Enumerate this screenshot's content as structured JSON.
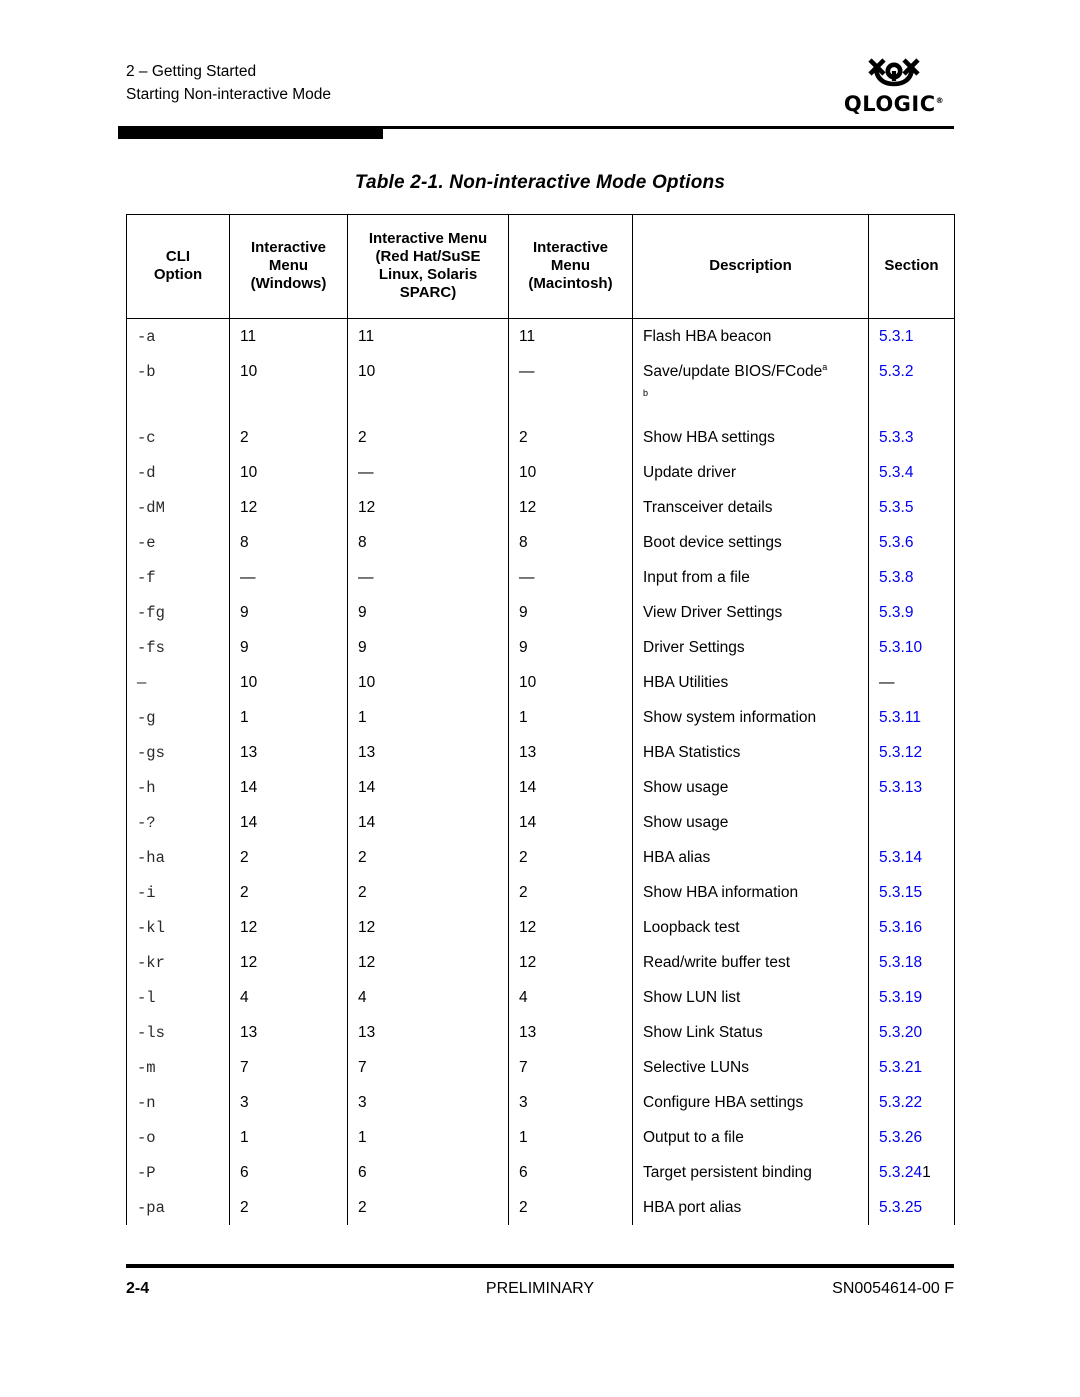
{
  "header": {
    "chapter": "2 – Getting Started",
    "section": "Starting Non-interactive Mode",
    "logo": {
      "mark": "qlogic-symbol",
      "wordmark": "QLOGIC",
      "trademark": "®"
    }
  },
  "table": {
    "caption": "Table 2-1. Non-interactive Mode Options",
    "columns": [
      {
        "key": "cli",
        "label": "CLI\nOption"
      },
      {
        "key": "windows",
        "label": "Interactive\nMenu\n(Windows)"
      },
      {
        "key": "linux",
        "label": "Interactive Menu\n(Red Hat/SuSE\nLinux, Solaris\nSPARC)"
      },
      {
        "key": "mac",
        "label": "Interactive\nMenu\n(Macintosh)"
      },
      {
        "key": "desc",
        "label": "Description"
      },
      {
        "key": "section",
        "label": "Section"
      }
    ],
    "column_labels": {
      "cli_line1": "CLI",
      "cli_line2": "Option",
      "win_line1": "Interactive",
      "win_line2": "Menu",
      "win_line3": "(Windows)",
      "linux_line1": "Interactive Menu",
      "linux_line2": "(Red Hat/SuSE",
      "linux_line3": "Linux, Solaris",
      "linux_line4": "SPARC)",
      "mac_line1": "Interactive",
      "mac_line2": "Menu",
      "mac_line3": "(Macintosh)",
      "desc": "Description",
      "section": "Section"
    },
    "rows": [
      {
        "cli": "-a",
        "windows": "11",
        "linux": "11",
        "mac": "11",
        "desc": "Flash HBA beacon",
        "section": "5.3.1"
      },
      {
        "cli": "-b",
        "windows": "10",
        "linux": "10",
        "mac": "—",
        "desc": "Save/update BIOS/FCode",
        "desc_footnote": "a",
        "desc_footnote2": "b",
        "section": "5.3.2",
        "tall": true
      },
      {
        "cli": "-c",
        "windows": "2",
        "linux": "2",
        "mac": "2",
        "desc": "Show HBA settings",
        "section": "5.3.3"
      },
      {
        "cli": "-d",
        "windows": "10",
        "linux": "—",
        "mac": "10",
        "desc": "Update driver",
        "section": "5.3.4"
      },
      {
        "cli": "-dM",
        "windows": "12",
        "linux": "12",
        "mac": "12",
        "desc": "Transceiver details",
        "section": "5.3.5"
      },
      {
        "cli": "-e",
        "windows": "8",
        "linux": "8",
        "mac": "8",
        "desc": "Boot device settings",
        "section": "5.3.6"
      },
      {
        "cli": "-f",
        "windows": "—",
        "linux": "—",
        "mac": "—",
        "desc": "Input from a file",
        "section": "5.3.8"
      },
      {
        "cli": "-fg",
        "windows": "9",
        "linux": "9",
        "mac": "9",
        "desc": "View Driver Settings",
        "section": "5.3.9"
      },
      {
        "cli": "-fs",
        "windows": "9",
        "linux": "9",
        "mac": "9",
        "desc": "Driver Settings",
        "section": "5.3.10"
      },
      {
        "cli": "—",
        "windows": "10",
        "linux": "10",
        "mac": "10",
        "desc": "HBA Utilities",
        "section": "—",
        "section_plain": true
      },
      {
        "cli": "-g",
        "windows": "1",
        "linux": "1",
        "mac": "1",
        "desc": "Show system information",
        "section": "5.3.11"
      },
      {
        "cli": "-gs",
        "windows": "13",
        "linux": "13",
        "mac": "13",
        "desc": "HBA Statistics",
        "section": "5.3.12"
      },
      {
        "cli": "-h",
        "windows": "14",
        "linux": "14",
        "mac": "14",
        "desc": "Show usage",
        "section": "5.3.13"
      },
      {
        "cli": "-?",
        "windows": "14",
        "linux": "14",
        "mac": "14",
        "desc": "Show usage",
        "section": ""
      },
      {
        "cli": "-ha",
        "windows": "2",
        "linux": "2",
        "mac": "2",
        "desc": "HBA alias",
        "section": "5.3.14"
      },
      {
        "cli": "-i",
        "windows": "2",
        "linux": "2",
        "mac": "2",
        "desc": "Show HBA information",
        "section": "5.3.15"
      },
      {
        "cli": "-kl",
        "windows": "12",
        "linux": "12",
        "mac": "12",
        "desc": "Loopback test",
        "section": "5.3.16"
      },
      {
        "cli": "-kr",
        "windows": "12",
        "linux": "12",
        "mac": "12",
        "desc": "Read/write buffer test",
        "section": "5.3.18"
      },
      {
        "cli": "-l",
        "windows": "4",
        "linux": "4",
        "mac": "4",
        "desc": "Show LUN list",
        "section": "5.3.19"
      },
      {
        "cli": "-ls",
        "windows": "13",
        "linux": "13",
        "mac": "13",
        "desc": "Show Link Status",
        "section": "5.3.20"
      },
      {
        "cli": "-m",
        "windows": "7",
        "linux": "7",
        "mac": "7",
        "desc": "Selective LUNs",
        "section": "5.3.21"
      },
      {
        "cli": "-n",
        "windows": "3",
        "linux": "3",
        "mac": "3",
        "desc": "Configure HBA settings",
        "section": "5.3.22"
      },
      {
        "cli": "-o",
        "windows": "1",
        "linux": "1",
        "mac": "1",
        "desc": "Output to a file",
        "section": "5.3.26"
      },
      {
        "cli": "-P",
        "windows": "6",
        "linux": "6",
        "mac": "6",
        "desc": "Target persistent binding",
        "section": "5.3.24",
        "section_overflow": "1"
      },
      {
        "cli": "-pa",
        "windows": "2",
        "linux": "2",
        "mac": "2",
        "desc": "HBA port alias",
        "section": "5.3.25"
      }
    ]
  },
  "footer": {
    "page_number": "2-4",
    "status": "PRELIMINARY",
    "document_id": "SN0054614-00  F"
  },
  "colors": {
    "link": "#0000f0",
    "text": "#000000",
    "rule": "#000000"
  }
}
